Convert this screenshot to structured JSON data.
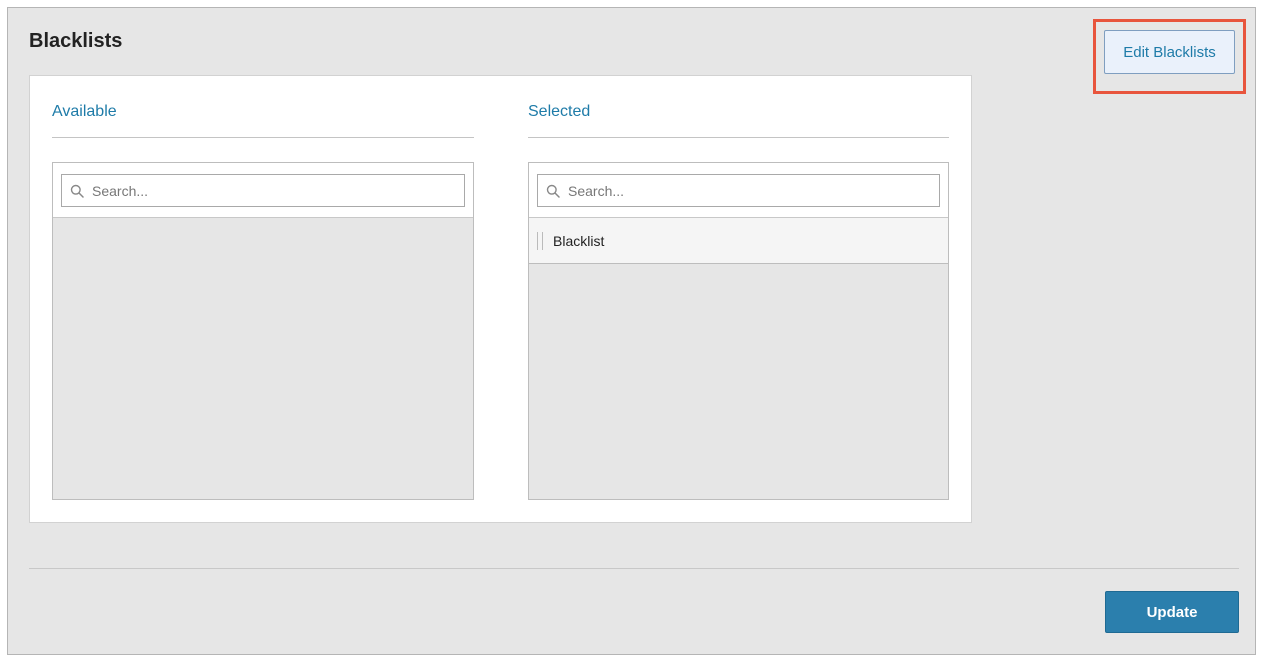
{
  "panel": {
    "title": "Blacklists",
    "edit_button_label": "Edit Blacklists",
    "update_button_label": "Update"
  },
  "available": {
    "title": "Available",
    "search_placeholder": "Search...",
    "items": []
  },
  "selected": {
    "title": "Selected",
    "search_placeholder": "Search...",
    "items": [
      {
        "label": "Blacklist"
      }
    ]
  },
  "colors": {
    "accent": "#1e7ba8",
    "primary_button": "#2b7fad",
    "highlight": "#e8553d",
    "panel_background": "#e6e6e6"
  },
  "icons": {
    "search": "search-icon",
    "drag": "drag-handle-icon"
  }
}
